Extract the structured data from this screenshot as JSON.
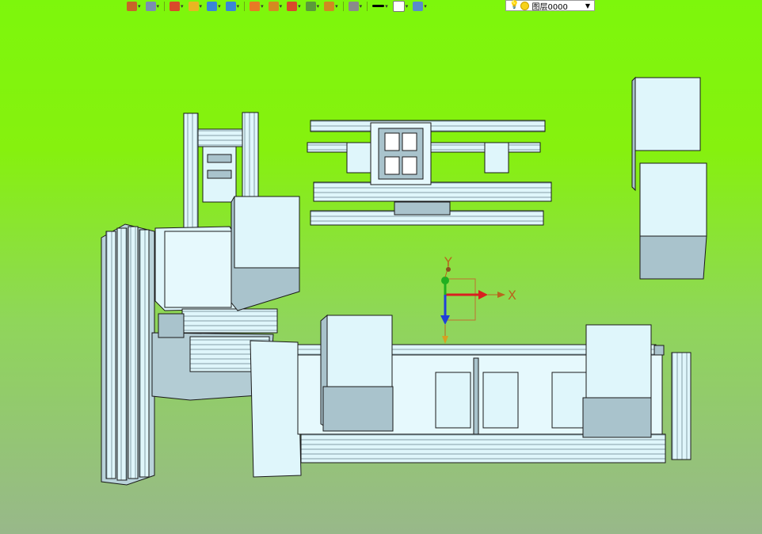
{
  "toolbar": {
    "buttons": [
      {
        "name": "exit-icon",
        "color": "#c86428"
      },
      {
        "name": "layers-stack-icon",
        "color": "#7a8fb0"
      },
      {
        "name": "pencil-icon",
        "color": "#d94a2a"
      },
      {
        "name": "solid-box-icon",
        "color": "#e8b622"
      },
      {
        "name": "cube-icon",
        "color": "#3a86d6"
      },
      {
        "name": "view-cube-icon",
        "color": "#3a86d6"
      },
      {
        "name": "render-wheel-icon",
        "color": "#e87a24"
      },
      {
        "name": "section-icon",
        "color": "#d48a20"
      },
      {
        "name": "snap-point-icon",
        "color": "#d94a2a"
      },
      {
        "name": "page-icon",
        "color": "#5a9a3a"
      },
      {
        "name": "frame-icon",
        "color": "#d08a20"
      },
      {
        "name": "cylinder-icon",
        "color": "#8a8a8a"
      },
      {
        "name": "line-weight-icon",
        "color": "#000000"
      },
      {
        "name": "color-swatch-icon",
        "color": "#ffffff"
      },
      {
        "name": "layer-icon",
        "color": "#5a8acc"
      }
    ],
    "layer_combo": {
      "value": "图层0000"
    }
  },
  "axis": {
    "x_label": "X",
    "y_label": "Y"
  },
  "colors": {
    "bg_top": "#7df70c",
    "bg_bottom": "#98b88a",
    "part_fill": "#dff6fb",
    "part_shade": "#a9c3cc",
    "edge": "#1a1a1a",
    "axis_x": "#d92020",
    "axis_y": "#20b020",
    "axis_z": "#2040d9",
    "axis_label": "#b8661e"
  }
}
